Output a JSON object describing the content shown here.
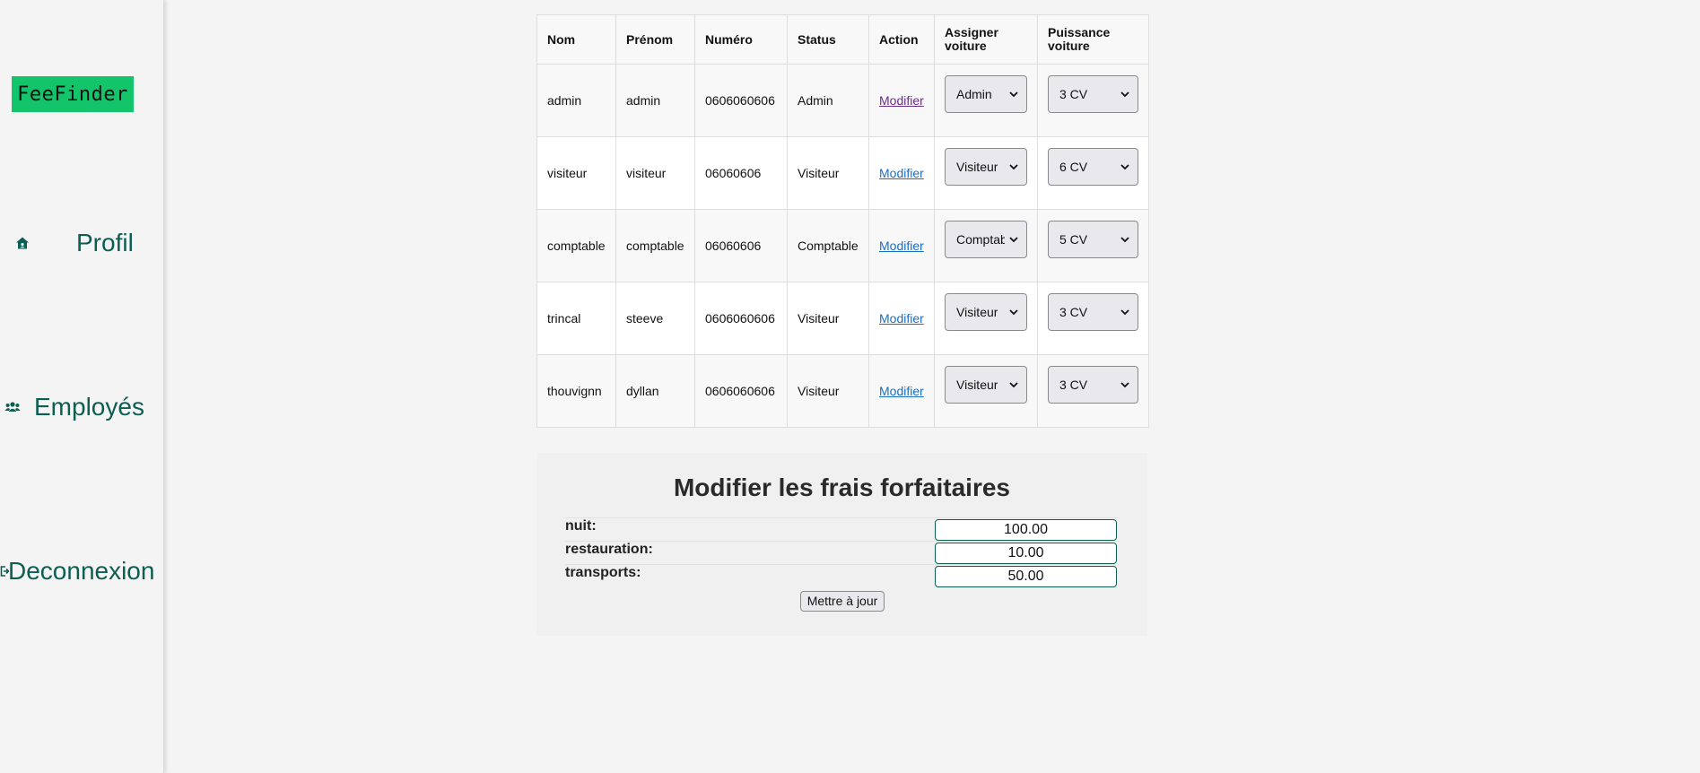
{
  "sidebar": {
    "logo": "FeeFinder",
    "items": [
      {
        "label": "Profil",
        "icon": "home-icon"
      },
      {
        "label": "Employés",
        "icon": "users-icon"
      },
      {
        "label": "Deconnexion",
        "icon": "logout-icon"
      }
    ]
  },
  "table": {
    "headers": [
      "Nom",
      "Prénom",
      "Numéro",
      "Status",
      "Action",
      "Assigner voiture",
      "Puissance voiture"
    ],
    "rows": [
      {
        "nom": "admin",
        "prenom": "admin",
        "numero": "0606060606",
        "status": "Admin",
        "action": "Modifier",
        "assigner": "Admin",
        "puissance": "3 CV"
      },
      {
        "nom": "visiteur",
        "prenom": "visiteur",
        "numero": "06060606",
        "status": "Visiteur",
        "action": "Modifier",
        "assigner": "Visiteur",
        "puissance": "6 CV"
      },
      {
        "nom": "comptable",
        "prenom": "comptable",
        "numero": "06060606",
        "status": "Comptable",
        "action": "Modifier",
        "assigner": "Comptable",
        "puissance": "5 CV"
      },
      {
        "nom": "trincal",
        "prenom": "steeve",
        "numero": "0606060606",
        "status": "Visiteur",
        "action": "Modifier",
        "assigner": "Visiteur",
        "puissance": "3 CV"
      },
      {
        "nom": "thouvignn",
        "prenom": "dyllan",
        "numero": "0606060606",
        "status": "Visiteur",
        "action": "Modifier",
        "assigner": "Visiteur",
        "puissance": "3 CV"
      }
    ]
  },
  "frais": {
    "title": "Modifier les frais forfaitaires",
    "fields": [
      {
        "label": "nuit:",
        "value": "100.00"
      },
      {
        "label": "restauration:",
        "value": "10.00"
      },
      {
        "label": "transports:",
        "value": "50.00"
      }
    ],
    "submit_label": "Mettre à jour"
  },
  "colors": {
    "accent": "#0d5e52",
    "logo_bg": "#14c46b",
    "link": "#1a6fc4",
    "link_visited": "#6b2c8a"
  }
}
